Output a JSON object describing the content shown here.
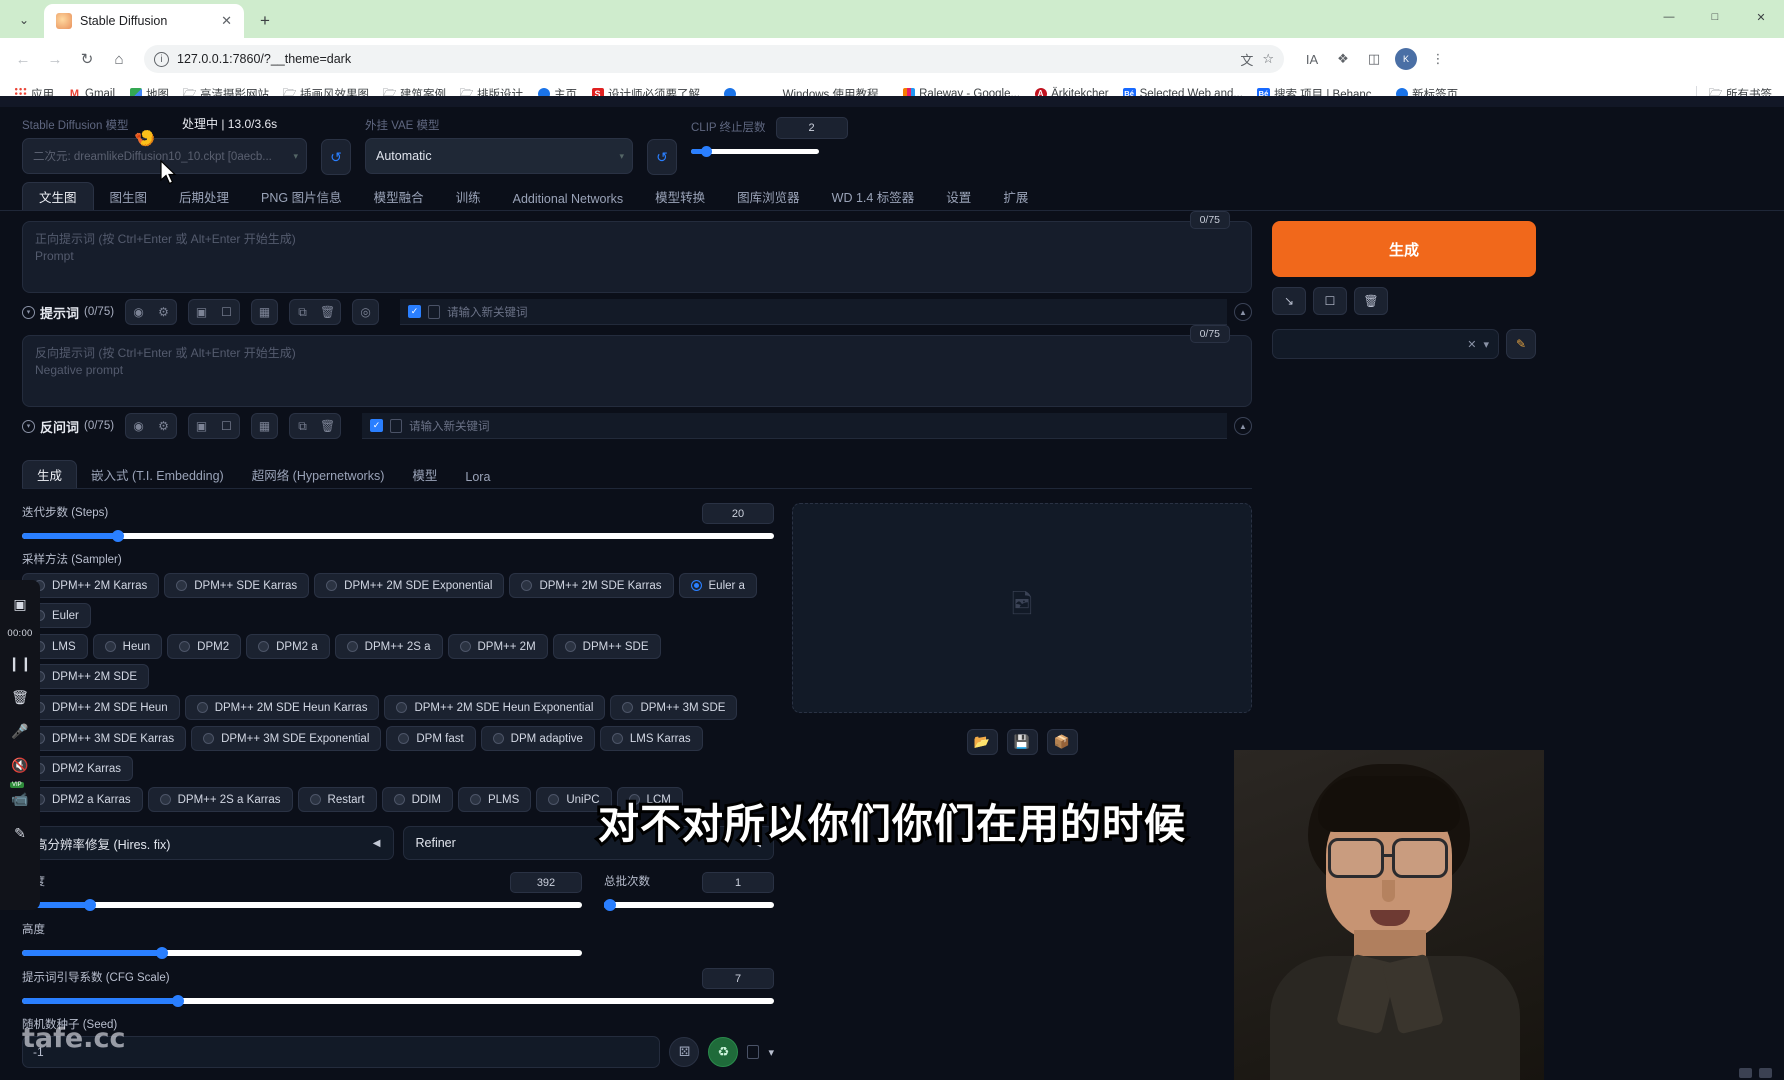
{
  "browser": {
    "tab": {
      "title": "Stable Diffusion",
      "favicon": "stable-diffusion-favicon",
      "close": "✕"
    },
    "new_tab": "+",
    "tab_list_chevron": "⌄",
    "window_controls": {
      "minimize": "—",
      "maximize": "□",
      "close": "✕"
    },
    "nav": {
      "back": "←",
      "forward": "→",
      "reload": "↻",
      "home": "⌂"
    },
    "omnibox": {
      "info_icon": "ⓘ",
      "url": "127.0.0.1:7860/?__theme=dark",
      "translate_icon": "文",
      "star_icon": "☆"
    },
    "toolbar_right": {
      "extension_a": "IA",
      "extension_b": "❖",
      "sidepanel": "◫",
      "profile_initials": "K",
      "menu": "⋮"
    },
    "bookmarks": [
      {
        "label": "应用",
        "icon": "apps-grid-icon"
      },
      {
        "label": "Gmail",
        "icon": "gmail-icon"
      },
      {
        "label": "地图",
        "icon": "maps-icon"
      },
      {
        "label": "高清摄影网站",
        "icon": "folder-icon"
      },
      {
        "label": "插画风效果图",
        "icon": "folder-icon"
      },
      {
        "label": "建筑案例",
        "icon": "folder-icon"
      },
      {
        "label": "排版设计",
        "icon": "folder-icon"
      },
      {
        "label": "主页",
        "icon": "globe-icon"
      },
      {
        "label": "设计师必须要了解...",
        "icon": "sogou-icon"
      },
      {
        "label": "",
        "icon": "globe-icon"
      },
      {
        "label": "Windows 使用教程...",
        "icon": "none"
      },
      {
        "label": "Raleway - Google...",
        "icon": "raleway-icon"
      },
      {
        "label": "Ärkitekcher",
        "icon": "arkitekcher-icon"
      },
      {
        "label": "Selected Web and...",
        "icon": "behance-icon"
      },
      {
        "label": "搜索 项目 | Behanc...",
        "icon": "behance-icon"
      },
      {
        "label": "新标签页",
        "icon": "globe-icon"
      }
    ],
    "bookmarks_all": {
      "label": "所有书签",
      "icon": "folder-icon"
    }
  },
  "webui": {
    "model": {
      "label": "Stable Diffusion 模型",
      "value": "二次元: dreamlikeDiffusion10_10.ckpt [0aecb...",
      "caret": "▾",
      "refresh_icon": "↺"
    },
    "status": "处理中  |  13.0/3.6s",
    "vae": {
      "label": "外挂 VAE 模型",
      "value": "Automatic",
      "caret": "▾",
      "refresh_icon": "↺"
    },
    "clip": {
      "label": "CLIP 终止层数",
      "value": "2"
    },
    "main_tabs": [
      "文生图",
      "图生图",
      "后期处理",
      "PNG 图片信息",
      "模型融合",
      "训练",
      "Additional Networks",
      "模型转换",
      "图库浏览器",
      "WD 1.4 标签器",
      "设置",
      "扩展"
    ],
    "active_main_tab": "文生图",
    "prompt": {
      "placeholder_line1": "正向提示词 (按 Ctrl+Enter 或 Alt+Enter 开始生成)",
      "placeholder_line2": "Prompt",
      "token_badge": "0/75",
      "title": "提示词",
      "count": "(0/75)",
      "keyword_placeholder": "请输入新关键词",
      "icons": [
        "globe-icon",
        "gear-icon",
        "list-icon",
        "bookmark-icon",
        "translate-icon",
        "copy-icon",
        "trash-icon",
        "palette-icon"
      ]
    },
    "negative_prompt": {
      "placeholder_line1": "反向提示词 (按 Ctrl+Enter 或 Alt+Enter 开始生成)",
      "placeholder_line2": "Negative prompt",
      "token_badge": "0/75",
      "title": "反问词",
      "count": "(0/75)",
      "keyword_placeholder": "请输入新关键词",
      "icons": [
        "globe-icon",
        "gear-icon",
        "list-icon",
        "bookmark-icon",
        "translate-icon",
        "copy-icon",
        "trash-icon"
      ]
    },
    "sub_tabs": [
      "生成",
      "嵌入式 (T.I. Embedding)",
      "超网络 (Hypernetworks)",
      "模型",
      "Lora"
    ],
    "active_sub_tab": "生成",
    "steps": {
      "label": "迭代步数 (Steps)",
      "value": "20",
      "percent": 13
    },
    "sampler": {
      "label": "采样方法 (Sampler)",
      "selected": "Euler a",
      "rows": [
        [
          "DPM++ 2M Karras",
          "DPM++ SDE Karras",
          "DPM++ 2M SDE Exponential",
          "DPM++ 2M SDE Karras",
          "Euler a",
          "Euler"
        ],
        [
          "LMS",
          "Heun",
          "DPM2",
          "DPM2 a",
          "DPM++ 2S a",
          "DPM++ 2M",
          "DPM++ SDE",
          "DPM++ 2M SDE"
        ],
        [
          "DPM++ 2M SDE Heun",
          "DPM++ 2M SDE Heun Karras",
          "DPM++ 2M SDE Heun Exponential",
          "DPM++ 3M SDE"
        ],
        [
          "DPM++ 3M SDE Karras",
          "DPM++ 3M SDE Exponential",
          "DPM fast",
          "DPM adaptive",
          "LMS Karras",
          "DPM2 Karras"
        ],
        [
          "DPM2 a Karras",
          "DPM++ 2S a Karras",
          "Restart",
          "DDIM",
          "PLMS",
          "UniPC",
          "LCM"
        ]
      ]
    },
    "accordions": [
      {
        "label": "高分辨率修复 (Hires. fix)",
        "arrow": "◀"
      },
      {
        "label": "Refiner",
        "arrow": "◀"
      }
    ],
    "width": {
      "label": "宽度",
      "value": "392",
      "percent": 12
    },
    "height": {
      "label": "高度",
      "value": "",
      "percent": 25
    },
    "batch_count": {
      "label": "总批次数",
      "value": "1",
      "percent": 0
    },
    "cfg": {
      "label": "提示词引导系数 (CFG Scale)",
      "value": "7",
      "percent": 21
    },
    "seed": {
      "label": "随机数种子 (Seed)",
      "value": "-1",
      "dice_icon": "⚄",
      "recycle_icon": "♻",
      "caret": "▾"
    },
    "preview": {
      "placeholder_icon": "image-placeholder-icon",
      "tools": [
        "folder-open-icon",
        "save-icon",
        "zip-icon"
      ]
    },
    "generate": {
      "label": "生成",
      "sub_buttons": [
        "arrow-down-icon",
        "clipboard-icon",
        "trash-icon"
      ]
    },
    "styles": {
      "clear_icon": "✕",
      "caret": "▾",
      "edit_icon": "✎"
    }
  },
  "overlay": {
    "recorder": {
      "screen_icon": "▣",
      "timer": "00:00",
      "pause_icon": "❙❙",
      "trash_icon": "🗑",
      "mic_icon": "🎤",
      "mute_icon": "🔇",
      "camera_icon": "📹",
      "pen_icon": "✎",
      "vip_badge": "VIP"
    },
    "subtitle": "对不对所以你们你们在用的时候",
    "watermark": "tafe.cc"
  }
}
